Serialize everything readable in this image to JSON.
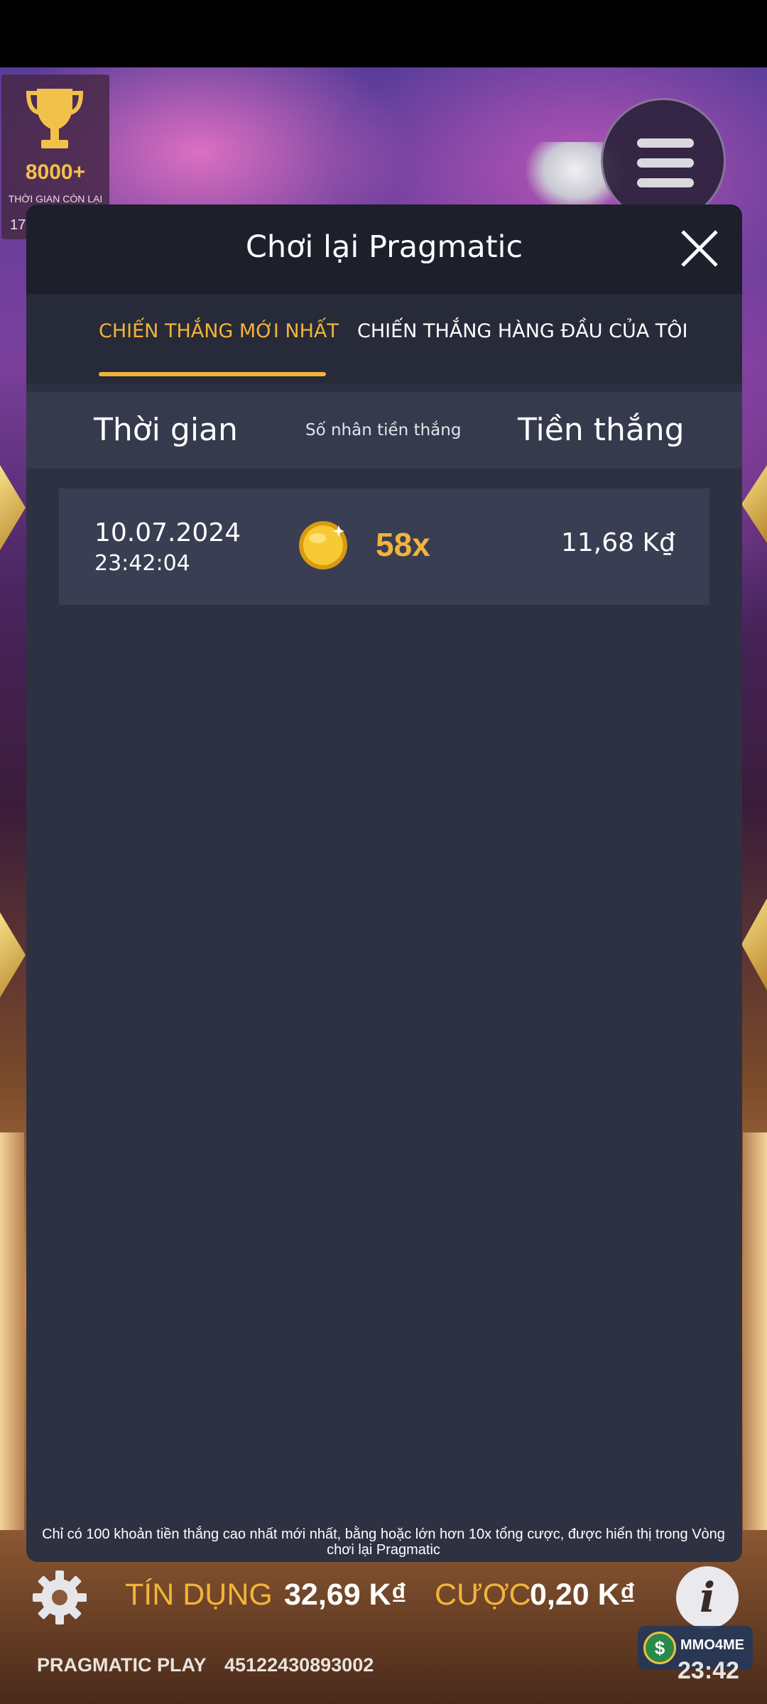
{
  "trophy": {
    "amount": "8000+",
    "label": "THỜI GIAN CÒN LẠI",
    "sub": "17"
  },
  "modal": {
    "title": "Chơi lại Pragmatic",
    "tabs": [
      {
        "label": "CHIẾN THẮNG MỚI NHẤT",
        "active": true
      },
      {
        "label": "CHIẾN THẮNG HÀNG ĐẦU CỦA TÔI",
        "active": false
      }
    ],
    "columns": {
      "time": "Thời gian",
      "multiplier": "Số nhân tiền thắng",
      "win": "Tiền thắng"
    },
    "rows": [
      {
        "date": "10.07.2024",
        "time": "23:42:04",
        "multiplier": "58x",
        "win": "11,68 K₫"
      }
    ],
    "footer_note": "Chỉ có 100 khoản tiền thắng cao nhất mới nhất, bằng hoặc lớn hơn 10x tổng cược, được hiển thị trong Vòng chơi lại Pragmatic"
  },
  "game_bar": {
    "credit_label": "TÍN DỤNG",
    "credit_value": "32,69 K₫",
    "bet_label": "CƯỢC",
    "bet_value": "0,20 K₫",
    "provider": "PRAGMATIC PLAY",
    "session_id": "45122430893002",
    "clock": "23:42"
  },
  "watermark": {
    "text": "MMO4ME",
    "coin_symbol": "$"
  },
  "colors": {
    "accent": "#f2b43a",
    "modal_bg": "#2e3142",
    "header_bg": "#1d1f2b"
  },
  "icons": {
    "close": "close-icon",
    "settings": "gear-icon",
    "info": "info-icon",
    "menu": "hamburger-icon",
    "trophy": "trophy-icon",
    "coin": "coin-icon"
  }
}
